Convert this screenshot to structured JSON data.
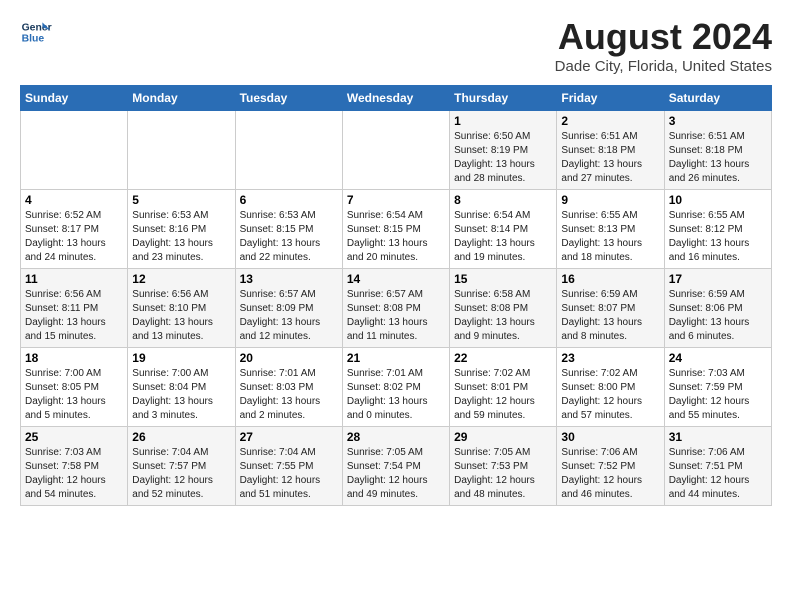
{
  "header": {
    "logo_line1": "General",
    "logo_line2": "Blue",
    "month_year": "August 2024",
    "location": "Dade City, Florida, United States"
  },
  "days_of_week": [
    "Sunday",
    "Monday",
    "Tuesday",
    "Wednesday",
    "Thursday",
    "Friday",
    "Saturday"
  ],
  "weeks": [
    [
      {
        "day": "",
        "info": ""
      },
      {
        "day": "",
        "info": ""
      },
      {
        "day": "",
        "info": ""
      },
      {
        "day": "",
        "info": ""
      },
      {
        "day": "1",
        "info": "Sunrise: 6:50 AM\nSunset: 8:19 PM\nDaylight: 13 hours\nand 28 minutes."
      },
      {
        "day": "2",
        "info": "Sunrise: 6:51 AM\nSunset: 8:18 PM\nDaylight: 13 hours\nand 27 minutes."
      },
      {
        "day": "3",
        "info": "Sunrise: 6:51 AM\nSunset: 8:18 PM\nDaylight: 13 hours\nand 26 minutes."
      }
    ],
    [
      {
        "day": "4",
        "info": "Sunrise: 6:52 AM\nSunset: 8:17 PM\nDaylight: 13 hours\nand 24 minutes."
      },
      {
        "day": "5",
        "info": "Sunrise: 6:53 AM\nSunset: 8:16 PM\nDaylight: 13 hours\nand 23 minutes."
      },
      {
        "day": "6",
        "info": "Sunrise: 6:53 AM\nSunset: 8:15 PM\nDaylight: 13 hours\nand 22 minutes."
      },
      {
        "day": "7",
        "info": "Sunrise: 6:54 AM\nSunset: 8:15 PM\nDaylight: 13 hours\nand 20 minutes."
      },
      {
        "day": "8",
        "info": "Sunrise: 6:54 AM\nSunset: 8:14 PM\nDaylight: 13 hours\nand 19 minutes."
      },
      {
        "day": "9",
        "info": "Sunrise: 6:55 AM\nSunset: 8:13 PM\nDaylight: 13 hours\nand 18 minutes."
      },
      {
        "day": "10",
        "info": "Sunrise: 6:55 AM\nSunset: 8:12 PM\nDaylight: 13 hours\nand 16 minutes."
      }
    ],
    [
      {
        "day": "11",
        "info": "Sunrise: 6:56 AM\nSunset: 8:11 PM\nDaylight: 13 hours\nand 15 minutes."
      },
      {
        "day": "12",
        "info": "Sunrise: 6:56 AM\nSunset: 8:10 PM\nDaylight: 13 hours\nand 13 minutes."
      },
      {
        "day": "13",
        "info": "Sunrise: 6:57 AM\nSunset: 8:09 PM\nDaylight: 13 hours\nand 12 minutes."
      },
      {
        "day": "14",
        "info": "Sunrise: 6:57 AM\nSunset: 8:08 PM\nDaylight: 13 hours\nand 11 minutes."
      },
      {
        "day": "15",
        "info": "Sunrise: 6:58 AM\nSunset: 8:08 PM\nDaylight: 13 hours\nand 9 minutes."
      },
      {
        "day": "16",
        "info": "Sunrise: 6:59 AM\nSunset: 8:07 PM\nDaylight: 13 hours\nand 8 minutes."
      },
      {
        "day": "17",
        "info": "Sunrise: 6:59 AM\nSunset: 8:06 PM\nDaylight: 13 hours\nand 6 minutes."
      }
    ],
    [
      {
        "day": "18",
        "info": "Sunrise: 7:00 AM\nSunset: 8:05 PM\nDaylight: 13 hours\nand 5 minutes."
      },
      {
        "day": "19",
        "info": "Sunrise: 7:00 AM\nSunset: 8:04 PM\nDaylight: 13 hours\nand 3 minutes."
      },
      {
        "day": "20",
        "info": "Sunrise: 7:01 AM\nSunset: 8:03 PM\nDaylight: 13 hours\nand 2 minutes."
      },
      {
        "day": "21",
        "info": "Sunrise: 7:01 AM\nSunset: 8:02 PM\nDaylight: 13 hours\nand 0 minutes."
      },
      {
        "day": "22",
        "info": "Sunrise: 7:02 AM\nSunset: 8:01 PM\nDaylight: 12 hours\nand 59 minutes."
      },
      {
        "day": "23",
        "info": "Sunrise: 7:02 AM\nSunset: 8:00 PM\nDaylight: 12 hours\nand 57 minutes."
      },
      {
        "day": "24",
        "info": "Sunrise: 7:03 AM\nSunset: 7:59 PM\nDaylight: 12 hours\nand 55 minutes."
      }
    ],
    [
      {
        "day": "25",
        "info": "Sunrise: 7:03 AM\nSunset: 7:58 PM\nDaylight: 12 hours\nand 54 minutes."
      },
      {
        "day": "26",
        "info": "Sunrise: 7:04 AM\nSunset: 7:57 PM\nDaylight: 12 hours\nand 52 minutes."
      },
      {
        "day": "27",
        "info": "Sunrise: 7:04 AM\nSunset: 7:55 PM\nDaylight: 12 hours\nand 51 minutes."
      },
      {
        "day": "28",
        "info": "Sunrise: 7:05 AM\nSunset: 7:54 PM\nDaylight: 12 hours\nand 49 minutes."
      },
      {
        "day": "29",
        "info": "Sunrise: 7:05 AM\nSunset: 7:53 PM\nDaylight: 12 hours\nand 48 minutes."
      },
      {
        "day": "30",
        "info": "Sunrise: 7:06 AM\nSunset: 7:52 PM\nDaylight: 12 hours\nand 46 minutes."
      },
      {
        "day": "31",
        "info": "Sunrise: 7:06 AM\nSunset: 7:51 PM\nDaylight: 12 hours\nand 44 minutes."
      }
    ]
  ]
}
